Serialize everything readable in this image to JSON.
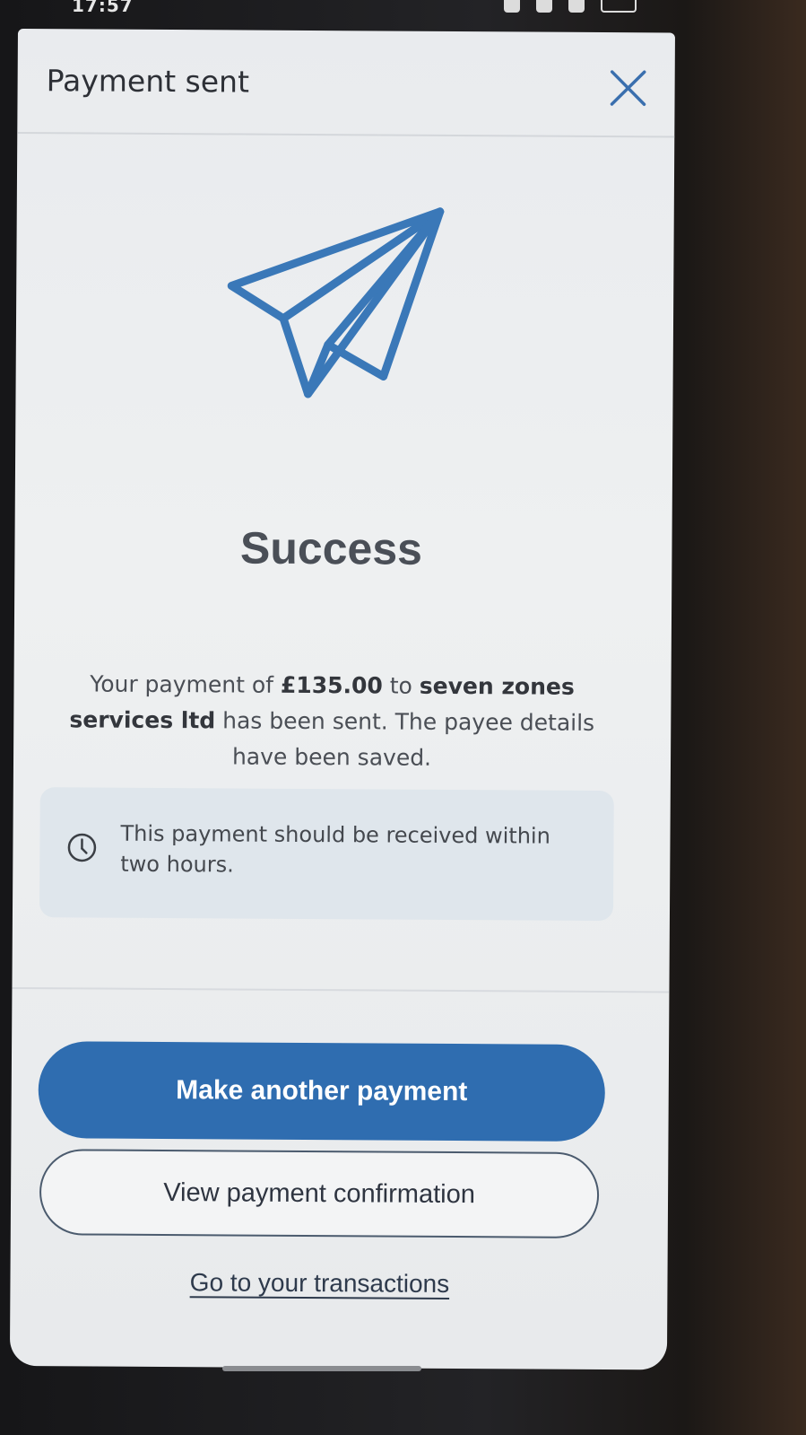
{
  "status_bar": {
    "time": "17:57"
  },
  "header": {
    "title": "Payment sent",
    "close_icon": "close-icon"
  },
  "illustration": {
    "icon": "paper-plane-icon",
    "color": "#3a78b8"
  },
  "main": {
    "heading": "Success",
    "message_prefix": "Your payment of ",
    "amount": "£135.00",
    "message_to": " to ",
    "payee": "seven zones services ltd",
    "message_suffix": " has been sent. The payee details have been saved."
  },
  "info": {
    "icon": "clock-icon",
    "text": "This payment should be received within two hours."
  },
  "actions": {
    "primary_label": "Make another payment",
    "secondary_label": "View payment confirmation",
    "link_label": "Go to your transactions"
  },
  "colors": {
    "accent": "#2f6db0",
    "info_bg": "#dfe6ec"
  }
}
